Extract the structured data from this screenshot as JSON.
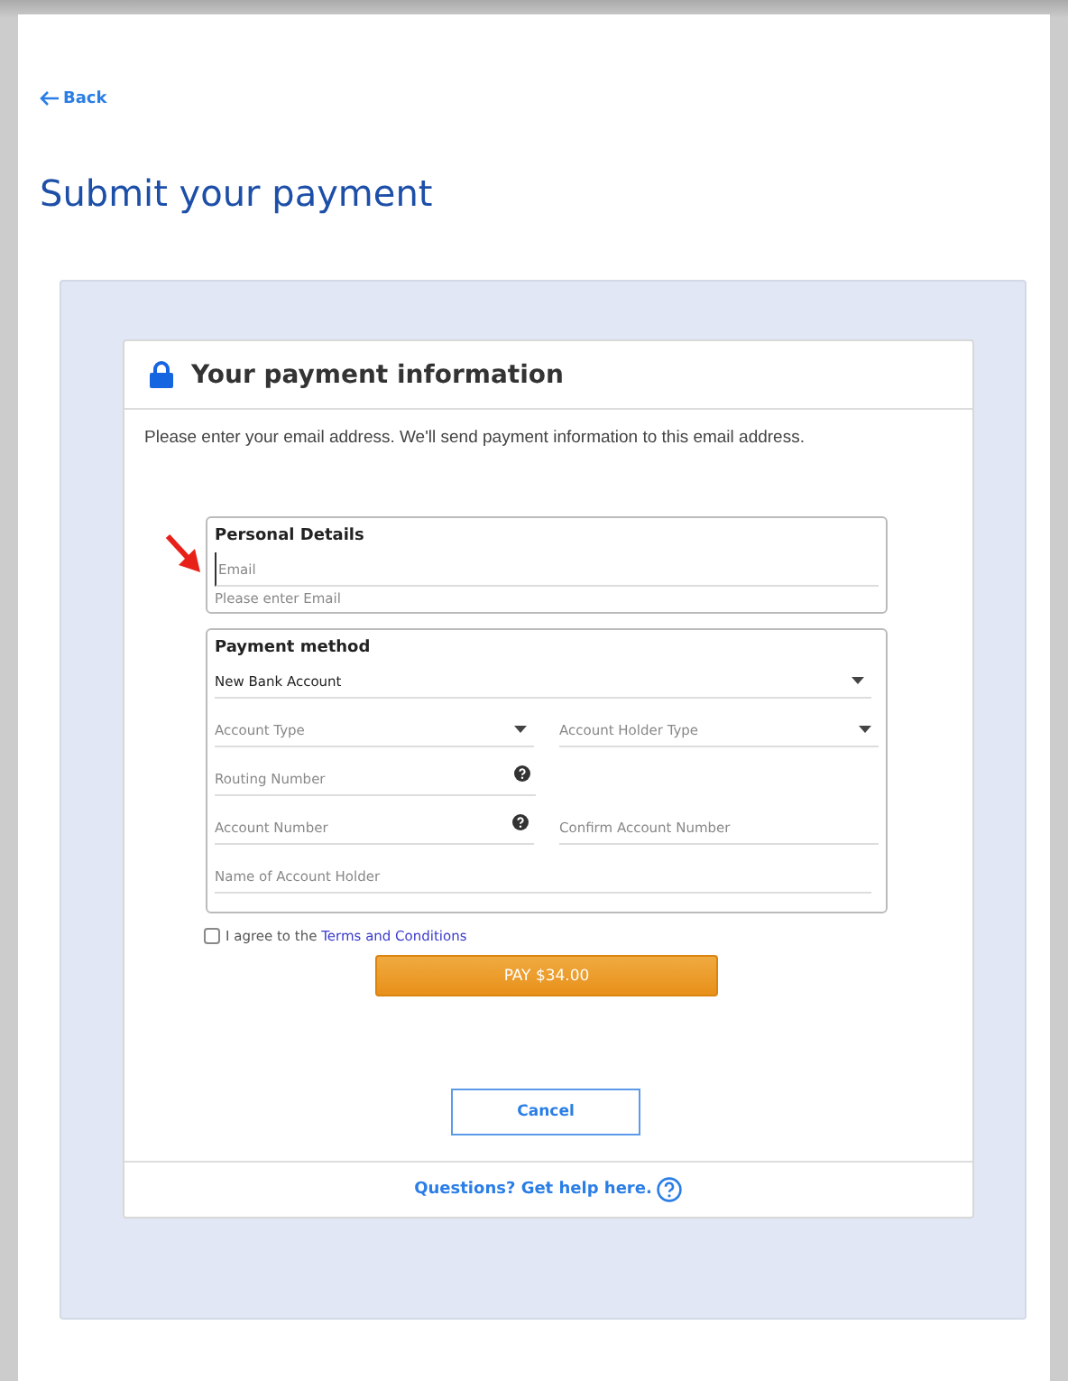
{
  "back_link": {
    "label": "Back"
  },
  "title": "Submit your payment",
  "card": {
    "title": "Your payment information",
    "intro": "Please enter your email address. We'll send payment information to this email address.",
    "personal_details": {
      "heading": "Personal Details",
      "email": {
        "placeholder": "Email",
        "focused": true,
        "hint": "Please enter Email"
      }
    },
    "payment_method": {
      "heading": "Payment method",
      "rows": [
        [
          {
            "kind": "select",
            "value": "New Bank Account"
          }
        ],
        [
          {
            "kind": "select",
            "placeholder": "Account Type"
          },
          {
            "kind": "select",
            "placeholder": "Account Holder Type"
          }
        ],
        [
          {
            "kind": "input",
            "placeholder": "Routing Number",
            "help": true
          }
        ],
        [
          {
            "kind": "input",
            "placeholder": "Account Number",
            "help": true
          },
          {
            "kind": "input",
            "placeholder": "Confirm Account Number"
          }
        ],
        [
          {
            "kind": "input",
            "placeholder": "Name of Account Holder"
          }
        ]
      ]
    },
    "agree": {
      "checked": false,
      "text": "I agree to the",
      "link": "Terms and Conditions"
    },
    "pay_button": "PAY $34.00",
    "cancel_button": "Cancel",
    "help_link": "Questions? Get help here."
  }
}
